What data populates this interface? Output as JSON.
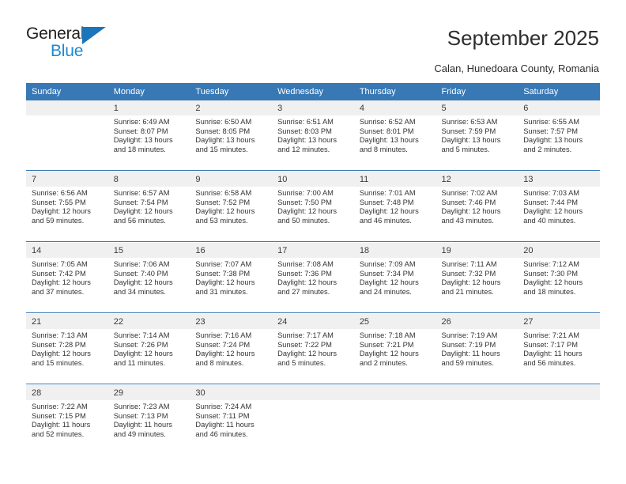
{
  "brand": {
    "name_top": "General",
    "name_bottom": "Blue",
    "accent_color": "#1b8ad1",
    "triangle_color": "#1b75bb"
  },
  "header": {
    "title": "September 2025",
    "subtitle": "Calan, Hunedoara County, Romania"
  },
  "calendar": {
    "header_bg": "#3778b5",
    "daynum_bg": "#f0f0f0",
    "weekdays": [
      "Sunday",
      "Monday",
      "Tuesday",
      "Wednesday",
      "Thursday",
      "Friday",
      "Saturday"
    ],
    "weeks": [
      {
        "days": [
          {
            "num": "",
            "sunrise": "",
            "sunset": "",
            "daylight1": "",
            "daylight2": ""
          },
          {
            "num": "1",
            "sunrise": "Sunrise: 6:49 AM",
            "sunset": "Sunset: 8:07 PM",
            "daylight1": "Daylight: 13 hours",
            "daylight2": "and 18 minutes."
          },
          {
            "num": "2",
            "sunrise": "Sunrise: 6:50 AM",
            "sunset": "Sunset: 8:05 PM",
            "daylight1": "Daylight: 13 hours",
            "daylight2": "and 15 minutes."
          },
          {
            "num": "3",
            "sunrise": "Sunrise: 6:51 AM",
            "sunset": "Sunset: 8:03 PM",
            "daylight1": "Daylight: 13 hours",
            "daylight2": "and 12 minutes."
          },
          {
            "num": "4",
            "sunrise": "Sunrise: 6:52 AM",
            "sunset": "Sunset: 8:01 PM",
            "daylight1": "Daylight: 13 hours",
            "daylight2": "and 8 minutes."
          },
          {
            "num": "5",
            "sunrise": "Sunrise: 6:53 AM",
            "sunset": "Sunset: 7:59 PM",
            "daylight1": "Daylight: 13 hours",
            "daylight2": "and 5 minutes."
          },
          {
            "num": "6",
            "sunrise": "Sunrise: 6:55 AM",
            "sunset": "Sunset: 7:57 PM",
            "daylight1": "Daylight: 13 hours",
            "daylight2": "and 2 minutes."
          }
        ]
      },
      {
        "days": [
          {
            "num": "7",
            "sunrise": "Sunrise: 6:56 AM",
            "sunset": "Sunset: 7:55 PM",
            "daylight1": "Daylight: 12 hours",
            "daylight2": "and 59 minutes."
          },
          {
            "num": "8",
            "sunrise": "Sunrise: 6:57 AM",
            "sunset": "Sunset: 7:54 PM",
            "daylight1": "Daylight: 12 hours",
            "daylight2": "and 56 minutes."
          },
          {
            "num": "9",
            "sunrise": "Sunrise: 6:58 AM",
            "sunset": "Sunset: 7:52 PM",
            "daylight1": "Daylight: 12 hours",
            "daylight2": "and 53 minutes."
          },
          {
            "num": "10",
            "sunrise": "Sunrise: 7:00 AM",
            "sunset": "Sunset: 7:50 PM",
            "daylight1": "Daylight: 12 hours",
            "daylight2": "and 50 minutes."
          },
          {
            "num": "11",
            "sunrise": "Sunrise: 7:01 AM",
            "sunset": "Sunset: 7:48 PM",
            "daylight1": "Daylight: 12 hours",
            "daylight2": "and 46 minutes."
          },
          {
            "num": "12",
            "sunrise": "Sunrise: 7:02 AM",
            "sunset": "Sunset: 7:46 PM",
            "daylight1": "Daylight: 12 hours",
            "daylight2": "and 43 minutes."
          },
          {
            "num": "13",
            "sunrise": "Sunrise: 7:03 AM",
            "sunset": "Sunset: 7:44 PM",
            "daylight1": "Daylight: 12 hours",
            "daylight2": "and 40 minutes."
          }
        ]
      },
      {
        "days": [
          {
            "num": "14",
            "sunrise": "Sunrise: 7:05 AM",
            "sunset": "Sunset: 7:42 PM",
            "daylight1": "Daylight: 12 hours",
            "daylight2": "and 37 minutes."
          },
          {
            "num": "15",
            "sunrise": "Sunrise: 7:06 AM",
            "sunset": "Sunset: 7:40 PM",
            "daylight1": "Daylight: 12 hours",
            "daylight2": "and 34 minutes."
          },
          {
            "num": "16",
            "sunrise": "Sunrise: 7:07 AM",
            "sunset": "Sunset: 7:38 PM",
            "daylight1": "Daylight: 12 hours",
            "daylight2": "and 31 minutes."
          },
          {
            "num": "17",
            "sunrise": "Sunrise: 7:08 AM",
            "sunset": "Sunset: 7:36 PM",
            "daylight1": "Daylight: 12 hours",
            "daylight2": "and 27 minutes."
          },
          {
            "num": "18",
            "sunrise": "Sunrise: 7:09 AM",
            "sunset": "Sunset: 7:34 PM",
            "daylight1": "Daylight: 12 hours",
            "daylight2": "and 24 minutes."
          },
          {
            "num": "19",
            "sunrise": "Sunrise: 7:11 AM",
            "sunset": "Sunset: 7:32 PM",
            "daylight1": "Daylight: 12 hours",
            "daylight2": "and 21 minutes."
          },
          {
            "num": "20",
            "sunrise": "Sunrise: 7:12 AM",
            "sunset": "Sunset: 7:30 PM",
            "daylight1": "Daylight: 12 hours",
            "daylight2": "and 18 minutes."
          }
        ]
      },
      {
        "days": [
          {
            "num": "21",
            "sunrise": "Sunrise: 7:13 AM",
            "sunset": "Sunset: 7:28 PM",
            "daylight1": "Daylight: 12 hours",
            "daylight2": "and 15 minutes."
          },
          {
            "num": "22",
            "sunrise": "Sunrise: 7:14 AM",
            "sunset": "Sunset: 7:26 PM",
            "daylight1": "Daylight: 12 hours",
            "daylight2": "and 11 minutes."
          },
          {
            "num": "23",
            "sunrise": "Sunrise: 7:16 AM",
            "sunset": "Sunset: 7:24 PM",
            "daylight1": "Daylight: 12 hours",
            "daylight2": "and 8 minutes."
          },
          {
            "num": "24",
            "sunrise": "Sunrise: 7:17 AM",
            "sunset": "Sunset: 7:22 PM",
            "daylight1": "Daylight: 12 hours",
            "daylight2": "and 5 minutes."
          },
          {
            "num": "25",
            "sunrise": "Sunrise: 7:18 AM",
            "sunset": "Sunset: 7:21 PM",
            "daylight1": "Daylight: 12 hours",
            "daylight2": "and 2 minutes."
          },
          {
            "num": "26",
            "sunrise": "Sunrise: 7:19 AM",
            "sunset": "Sunset: 7:19 PM",
            "daylight1": "Daylight: 11 hours",
            "daylight2": "and 59 minutes."
          },
          {
            "num": "27",
            "sunrise": "Sunrise: 7:21 AM",
            "sunset": "Sunset: 7:17 PM",
            "daylight1": "Daylight: 11 hours",
            "daylight2": "and 56 minutes."
          }
        ]
      },
      {
        "days": [
          {
            "num": "28",
            "sunrise": "Sunrise: 7:22 AM",
            "sunset": "Sunset: 7:15 PM",
            "daylight1": "Daylight: 11 hours",
            "daylight2": "and 52 minutes."
          },
          {
            "num": "29",
            "sunrise": "Sunrise: 7:23 AM",
            "sunset": "Sunset: 7:13 PM",
            "daylight1": "Daylight: 11 hours",
            "daylight2": "and 49 minutes."
          },
          {
            "num": "30",
            "sunrise": "Sunrise: 7:24 AM",
            "sunset": "Sunset: 7:11 PM",
            "daylight1": "Daylight: 11 hours",
            "daylight2": "and 46 minutes."
          },
          {
            "num": "",
            "sunrise": "",
            "sunset": "",
            "daylight1": "",
            "daylight2": ""
          },
          {
            "num": "",
            "sunrise": "",
            "sunset": "",
            "daylight1": "",
            "daylight2": ""
          },
          {
            "num": "",
            "sunrise": "",
            "sunset": "",
            "daylight1": "",
            "daylight2": ""
          },
          {
            "num": "",
            "sunrise": "",
            "sunset": "",
            "daylight1": "",
            "daylight2": ""
          }
        ]
      }
    ]
  }
}
